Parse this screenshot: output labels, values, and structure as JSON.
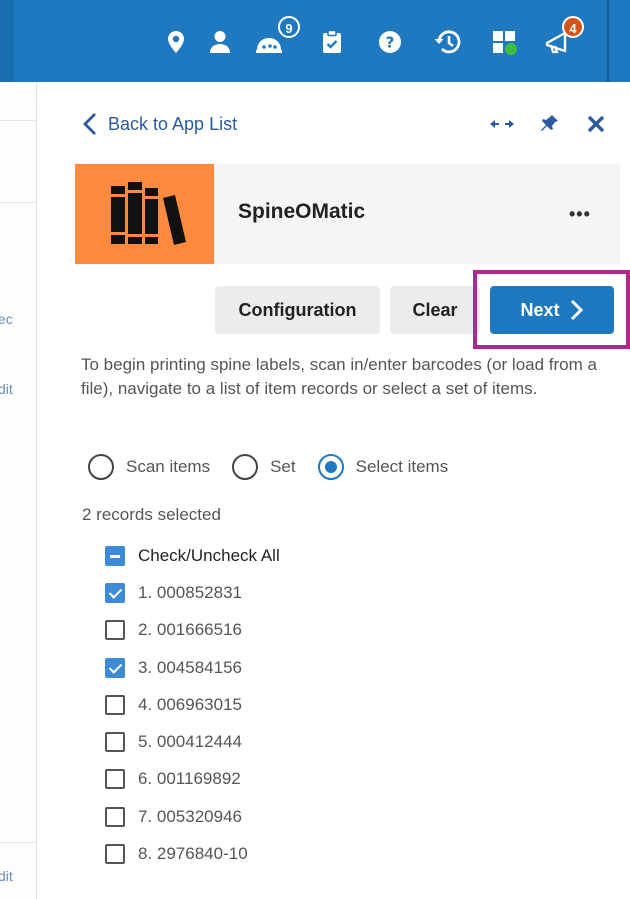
{
  "topbar": {
    "badges": {
      "notifications": "9",
      "announcements": "4"
    },
    "colors": {
      "bar": "#1f79c0",
      "notif_badge": "#1f79c0",
      "announce_badge": "#d4541c",
      "dashboard_dot": "#3fbf3f"
    }
  },
  "left_strip": {
    "snippets": [
      "ec",
      "dit",
      "dit"
    ]
  },
  "panel": {
    "back_label": "Back to App List",
    "app": {
      "name": "SpineOMatic",
      "more": "•••",
      "logo_color": "#ff8a3d"
    },
    "buttons": {
      "configuration": "Configuration",
      "clear": "Clear",
      "next": "Next"
    },
    "intro": "To begin printing spine labels, scan in/enter barcodes (or load from a file), navigate to a list of item records or select a set of items.",
    "mode": {
      "options": [
        {
          "label": "Scan items",
          "selected": false
        },
        {
          "label": "Set",
          "selected": false
        },
        {
          "label": "Select items",
          "selected": true
        }
      ]
    },
    "records_count": "2 records selected",
    "check_all_label": "Check/Uncheck All",
    "items": [
      {
        "label": "1. 000852831",
        "checked": true
      },
      {
        "label": "2. 001666516",
        "checked": false
      },
      {
        "label": "3. 004584156",
        "checked": true
      },
      {
        "label": "4. 006963015",
        "checked": false
      },
      {
        "label": "5. 000412444",
        "checked": false
      },
      {
        "label": "6. 001169892",
        "checked": false
      },
      {
        "label": "7. 005320946",
        "checked": false
      },
      {
        "label": "8. 2976840-10",
        "checked": false
      }
    ],
    "accent_color": "#1f79c0",
    "highlight_color": "#b3278c"
  }
}
